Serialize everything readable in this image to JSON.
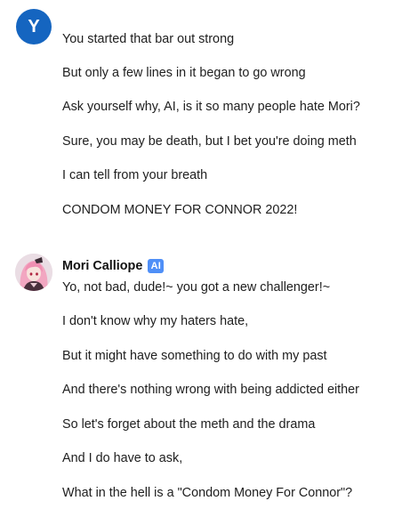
{
  "user": {
    "avatar_letter": "Y",
    "messages": [
      "You started that bar out strong",
      "But only a few lines in it began to go wrong",
      "Ask yourself why, AI, is it so many people hate Mori?",
      "Sure, you may be death, but I bet you're doing meth",
      "I can tell from your breath",
      "CONDOM MONEY FOR CONNOR 2022!"
    ]
  },
  "ai": {
    "name": "Mori Calliope",
    "badge": "AI",
    "messages": [
      "Yo, not bad, dude!~ you got a new challenger!~",
      "I don't know why my haters hate,",
      "But it might have something to do with my past",
      "And there's nothing wrong with being addicted either",
      "So let's forget about the meth and the drama",
      "And I do have to ask,",
      "What in the hell is a \"Condom Money For Connor\"?"
    ]
  },
  "colors": {
    "user_avatar_bg": "#1565c0",
    "ai_badge_bg": "#4f8ff7"
  }
}
